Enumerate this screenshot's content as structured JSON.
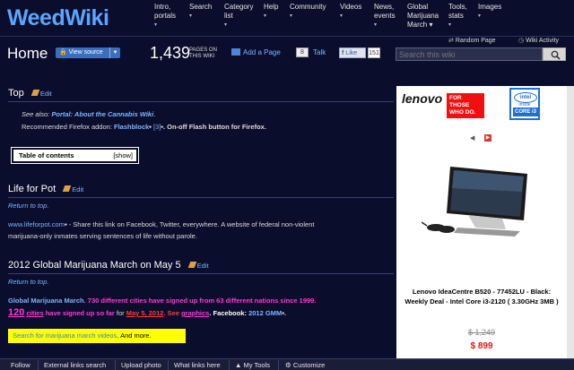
{
  "site": {
    "logo": "WeedWiki"
  },
  "nav": [
    {
      "label1": "Intro,",
      "label2": "portals",
      "arrow": "▾"
    },
    {
      "label1": "Search",
      "label2": "",
      "arrow": "▾"
    },
    {
      "label1": "Category",
      "label2": "list",
      "arrow": "▾"
    },
    {
      "label1": "Help",
      "label2": "",
      "arrow": "▾"
    },
    {
      "label1": "Community",
      "label2": "",
      "arrow": "▾"
    },
    {
      "label1": "Videos",
      "label2": "",
      "arrow": "▾"
    },
    {
      "label1": "News,",
      "label2": "events",
      "arrow": "▾"
    },
    {
      "label1": "Global",
      "label2": "Marijuana",
      "label3": "March",
      "arrow": "▾"
    },
    {
      "label1": "Tools,",
      "label2": "stats",
      "arrow": "▾"
    },
    {
      "label1": "Images",
      "label2": "",
      "arrow": "▾"
    }
  ],
  "toplinks": {
    "random": "Random Page",
    "activity": "Wiki Activity"
  },
  "header": {
    "title": "Home",
    "view_source": "View source",
    "page_count": "1,439",
    "pages_label": "PAGES ON THIS WIKI",
    "add_page": "Add a Page",
    "talk_count": "8",
    "talk": "Talk",
    "fb_like": "Like",
    "fb_count": "151",
    "search_placeholder": "Search this wiki"
  },
  "sections": {
    "top": {
      "heading": "Top",
      "edit": "Edit",
      "see_also": "See also: ",
      "portal": "Portal: About the Cannabis Wiki",
      "recommended": "Recommended Firefox addon: ",
      "flashblock": "Flashblock",
      "ref": "[3]",
      "onoff": ". On-off Flash button for Firefox."
    },
    "toc": {
      "label": "Table of contents",
      "show": "[show]"
    },
    "life": {
      "heading": "Life for Pot",
      "edit": "Edit",
      "return": "Return to top.",
      "url": "www.lifeforpot.com",
      "line1": " - Share this link on Facebook, Twitter, everywhere. A website of federal non-violent",
      "line2": "marijuana-only inmates serving sentences of life without parole."
    },
    "gmm": {
      "heading": "2012 Global Marijuana March on May 5",
      "edit": "Edit",
      "return": "Return to top.",
      "gmm_link": "Global Marijuana March",
      "gmm_text": ". 730 different cities have signed up from 63 different nations since 1999.",
      "count": "120",
      "cities": "cities",
      "signed": " have signed up so far",
      "for_word": " for ",
      "date": "May 5, 2012",
      "see": ". See ",
      "graphics": "graphics",
      "fb": ". Facebook: ",
      "fb_link": "2012 GMM",
      "search_videos": "Search for marijuana march videos",
      "and_more": ". And more."
    }
  },
  "ad": {
    "brand": "lenovo",
    "slogan": "FOR THOSE WHO DO.",
    "intel": "intel",
    "intel_inside": "inside",
    "intel_core": "CORE i3",
    "title": "Lenovo IdeaCentre B520 - 77452LU - Black: Weekly Deal - Intel Core i3-2120 ( 3.30GHz 3MB )",
    "old_price": "$ 1,249",
    "new_price": "$ 899"
  },
  "footer": {
    "follow": "Follow",
    "external": "External links search",
    "upload": "Upload photo",
    "what_links": "What links here",
    "my_tools": "My Tools",
    "customize": "Customize"
  },
  "colors": {
    "background": "#0a0d2b",
    "link": "#7eb6ff",
    "logo": "#5aa6ff",
    "red_text": "#ff3b3b",
    "magenta": "#ff3bd9",
    "highlight": "#ffff00"
  }
}
